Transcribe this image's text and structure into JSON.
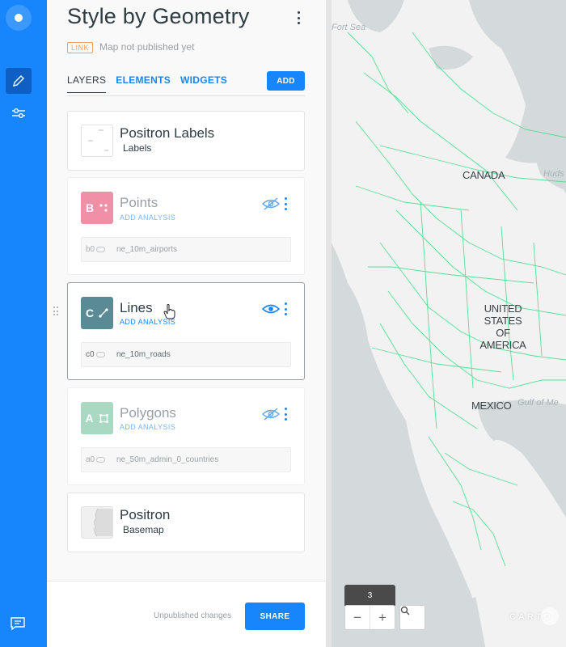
{
  "header": {
    "title": "Style by Geometry",
    "badge": "LINK",
    "publish_status": "Map not published yet"
  },
  "tabs": [
    {
      "label": "LAYERS",
      "active": true
    },
    {
      "label": "ELEMENTS",
      "active": false
    },
    {
      "label": "WIDGETS",
      "active": false
    }
  ],
  "add_button": "ADD",
  "layers": [
    {
      "name": "Positron Labels",
      "subtitle": "Labels",
      "type": "labels"
    },
    {
      "letter": "B",
      "name": "Points",
      "analysis": "ADD ANALYSIS",
      "node_id": "b0",
      "source": "ne_10m_airports",
      "visible": false,
      "color": "#f08fa6"
    },
    {
      "letter": "C",
      "name": "Lines",
      "analysis": "ADD ANALYSIS",
      "node_id": "c0",
      "source": "ne_10m_roads",
      "visible": true,
      "color": "#5b8a97"
    },
    {
      "letter": "A",
      "name": "Polygons",
      "analysis": "ADD ANALYSIS",
      "node_id": "a0",
      "source": "ne_50m_admin_0_countries",
      "visible": false,
      "color": "#a9d8c3"
    },
    {
      "name": "Positron",
      "subtitle": "Basemap",
      "type": "basemap"
    }
  ],
  "footer": {
    "status": "Unpublished changes",
    "share": "SHARE"
  },
  "map": {
    "labels": {
      "canada": "CANADA",
      "usa_line1": "UNITED",
      "usa_line2": "STATES OF",
      "usa_line3": "AMERICA",
      "mexico": "MEXICO",
      "hudson": "Huds",
      "fort_sea": "Fort Sea",
      "gulf": "Gulf of Me"
    },
    "zoom": "3",
    "attribution": "CARTO"
  },
  "colors": {
    "accent": "#1785fb",
    "roads": "#3ddc84",
    "land": "#f2f2f2",
    "water": "#d4dadc"
  }
}
